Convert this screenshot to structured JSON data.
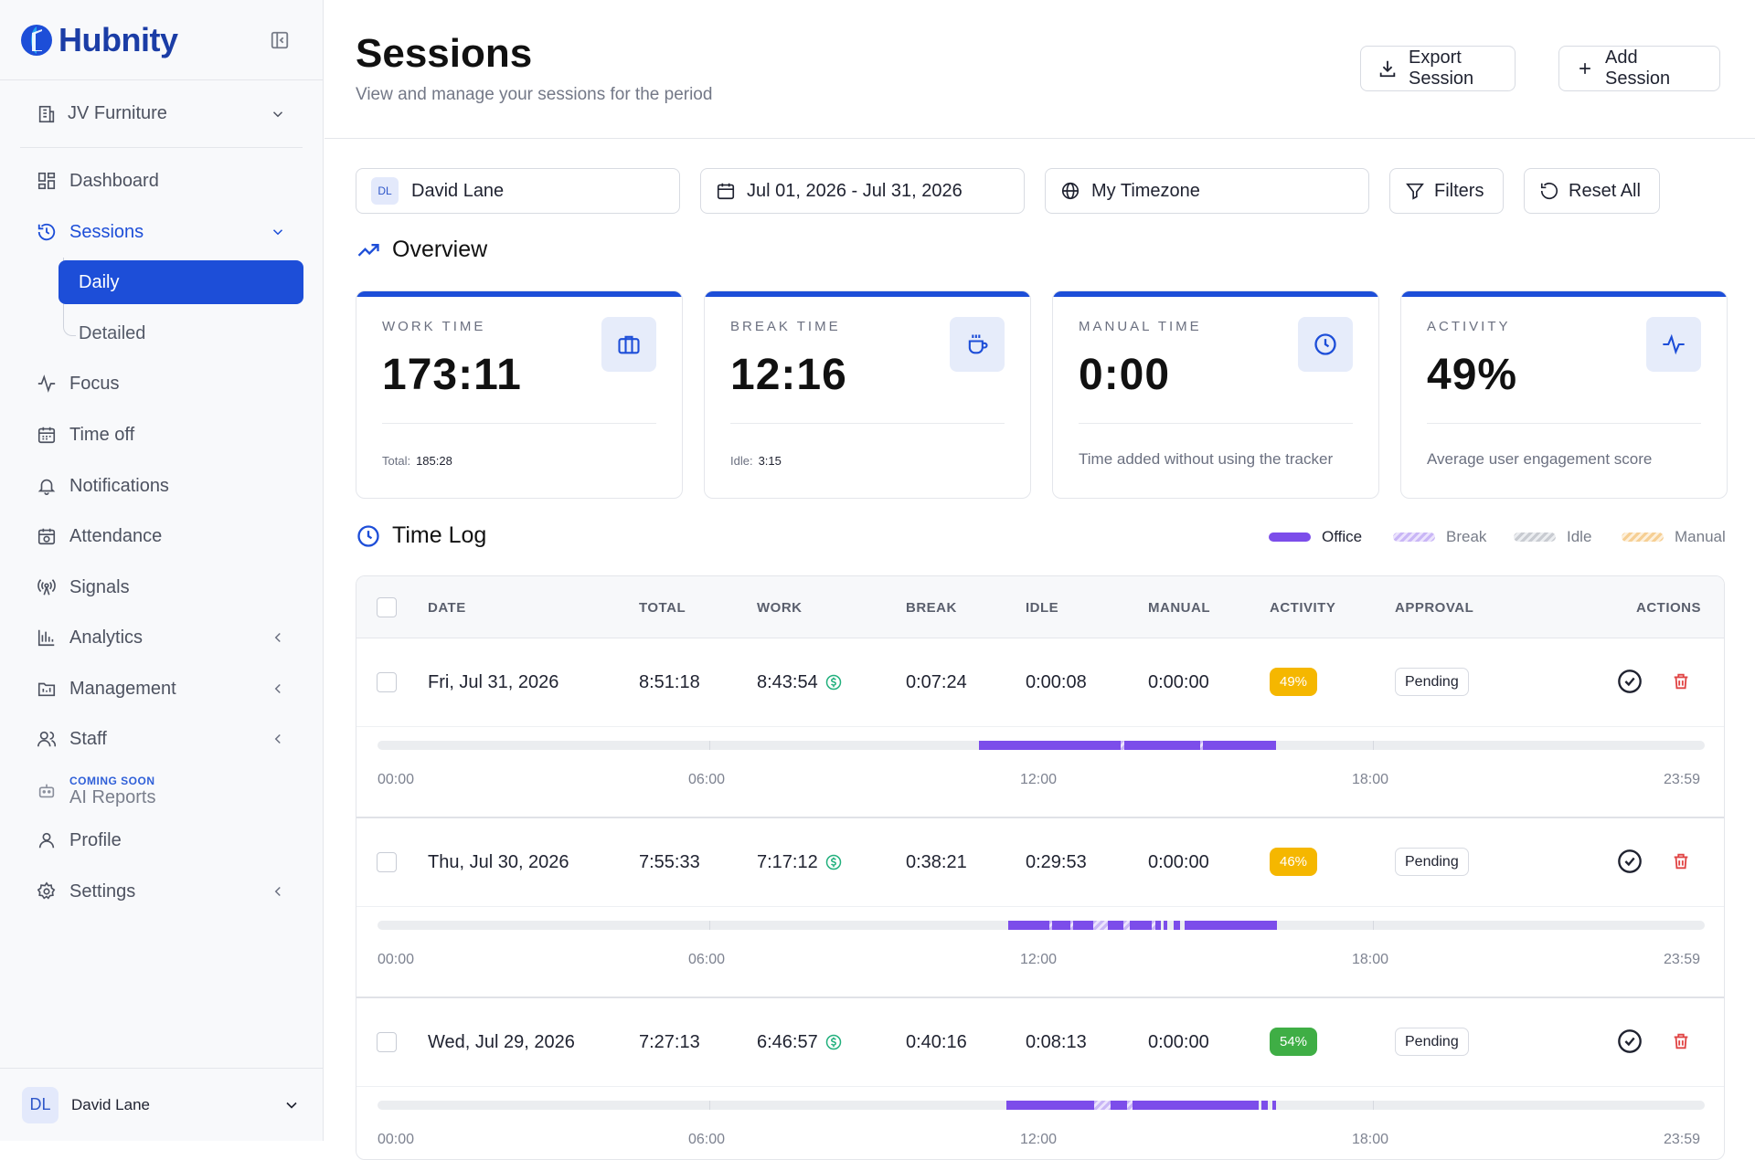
{
  "brand": {
    "name": "Hubnity",
    "color": "#1d4ed8"
  },
  "sidebar": {
    "org": "JV Furniture",
    "items": [
      {
        "label": "Dashboard",
        "icon": "dashboard-icon"
      },
      {
        "label": "Sessions",
        "icon": "history-icon",
        "active": true
      },
      {
        "label": "Focus",
        "icon": "activity-icon"
      },
      {
        "label": "Time off",
        "icon": "calendar-icon"
      },
      {
        "label": "Notifications",
        "icon": "bell-icon"
      },
      {
        "label": "Attendance",
        "icon": "calendar-clock-icon"
      },
      {
        "label": "Signals",
        "icon": "radio-signal-icon"
      },
      {
        "label": "Analytics",
        "icon": "bar-chart-icon"
      },
      {
        "label": "Management",
        "icon": "folder-icon"
      },
      {
        "label": "Staff",
        "icon": "users-icon"
      },
      {
        "label": "AI Reports",
        "icon": "robot-icon",
        "badge": "COMING SOON"
      },
      {
        "label": "Profile",
        "icon": "user-icon"
      },
      {
        "label": "Settings",
        "icon": "gear-icon"
      }
    ],
    "sessions_sub": [
      "Daily",
      "Detailed"
    ],
    "user": {
      "initials": "DL",
      "name": "David Lane"
    }
  },
  "header": {
    "title": "Sessions",
    "subtitle": "View and manage your sessions for the period",
    "export_label": "Export Session",
    "add_label": "Add Session"
  },
  "filters": {
    "user_initials": "DL",
    "user": "David Lane",
    "date_range": "Jul 01, 2026 - Jul 31, 2026",
    "timezone": "My Timezone",
    "filters_label": "Filters",
    "reset_label": "Reset All"
  },
  "overview": {
    "title": "Overview",
    "cards": [
      {
        "label": "WORK TIME",
        "value": "173:11",
        "foot_label": "Total:",
        "foot_value": "185:28",
        "icon": "briefcase-icon"
      },
      {
        "label": "BREAK TIME",
        "value": "12:16",
        "foot_label": "Idle:",
        "foot_value": "3:15",
        "icon": "coffee-icon"
      },
      {
        "label": "MANUAL TIME",
        "value": "0:00",
        "foot_label": "Time added without using the tracker",
        "foot_value": "",
        "icon": "clock-icon"
      },
      {
        "label": "ACTIVITY",
        "value": "49%",
        "foot_label": "Average user engagement score",
        "foot_value": "",
        "icon": "pulse-icon"
      }
    ]
  },
  "timelog": {
    "title": "Time Log",
    "legend": [
      {
        "label": "Office",
        "color": "#7c4dea"
      },
      {
        "label": "Break",
        "color": "#c9b6f6"
      },
      {
        "label": "Idle",
        "color": "#c8cbd1"
      },
      {
        "label": "Manual",
        "color": "#f6cf94"
      }
    ],
    "columns": [
      "DATE",
      "TOTAL",
      "WORK",
      "BREAK",
      "IDLE",
      "MANUAL",
      "ACTIVITY",
      "APPROVAL",
      "ACTIONS"
    ],
    "axis_labels": [
      "00:00",
      "06:00",
      "12:00",
      "18:00",
      "23:59"
    ],
    "rows": [
      {
        "date": "Fri, Jul 31, 2026",
        "total": "8:51:18",
        "work": "8:43:54",
        "break": "0:07:24",
        "idle": "0:00:08",
        "manual": "0:00:00",
        "activity": "49%",
        "activity_color": "#f5b700",
        "approval": "Pending",
        "segments": [
          {
            "t": "office",
            "s": 0.453,
            "e": 0.56
          },
          {
            "t": "brk",
            "s": 0.56,
            "e": 0.563
          },
          {
            "t": "office",
            "s": 0.563,
            "e": 0.62
          },
          {
            "t": "brk",
            "s": 0.62,
            "e": 0.622
          },
          {
            "t": "office",
            "s": 0.622,
            "e": 0.677
          }
        ]
      },
      {
        "date": "Thu, Jul 30, 2026",
        "total": "7:55:33",
        "work": "7:17:12",
        "break": "0:38:21",
        "idle": "0:29:53",
        "manual": "0:00:00",
        "activity": "46%",
        "activity_color": "#f5b700",
        "approval": "Pending",
        "segments": [
          {
            "t": "office",
            "s": 0.475,
            "e": 0.506
          },
          {
            "t": "brk",
            "s": 0.506,
            "e": 0.508
          },
          {
            "t": "office",
            "s": 0.508,
            "e": 0.522
          },
          {
            "t": "brk",
            "s": 0.522,
            "e": 0.524
          },
          {
            "t": "office",
            "s": 0.524,
            "e": 0.539
          },
          {
            "t": "brk",
            "s": 0.539,
            "e": 0.55
          },
          {
            "t": "office",
            "s": 0.55,
            "e": 0.562
          },
          {
            "t": "brk",
            "s": 0.562,
            "e": 0.567
          },
          {
            "t": "office",
            "s": 0.567,
            "e": 0.583
          },
          {
            "t": "brk",
            "s": 0.583,
            "e": 0.586
          },
          {
            "t": "office",
            "s": 0.586,
            "e": 0.59
          },
          {
            "t": "office",
            "s": 0.592,
            "e": 0.595
          },
          {
            "t": "office",
            "s": 0.6,
            "e": 0.605
          },
          {
            "t": "office",
            "s": 0.608,
            "e": 0.678
          }
        ]
      },
      {
        "date": "Wed, Jul 29, 2026",
        "total": "7:27:13",
        "work": "6:46:57",
        "break": "0:40:16",
        "idle": "0:08:13",
        "manual": "0:00:00",
        "activity": "54%",
        "activity_color": "#3fae45",
        "approval": "Pending",
        "segments": [
          {
            "t": "office",
            "s": 0.474,
            "e": 0.54
          },
          {
            "t": "brk",
            "s": 0.54,
            "e": 0.552
          },
          {
            "t": "office",
            "s": 0.552,
            "e": 0.565
          },
          {
            "t": "brk",
            "s": 0.565,
            "e": 0.569
          },
          {
            "t": "office",
            "s": 0.569,
            "e": 0.664
          },
          {
            "t": "office",
            "s": 0.666,
            "e": 0.671
          },
          {
            "t": "office",
            "s": 0.674,
            "e": 0.677
          }
        ]
      }
    ]
  }
}
